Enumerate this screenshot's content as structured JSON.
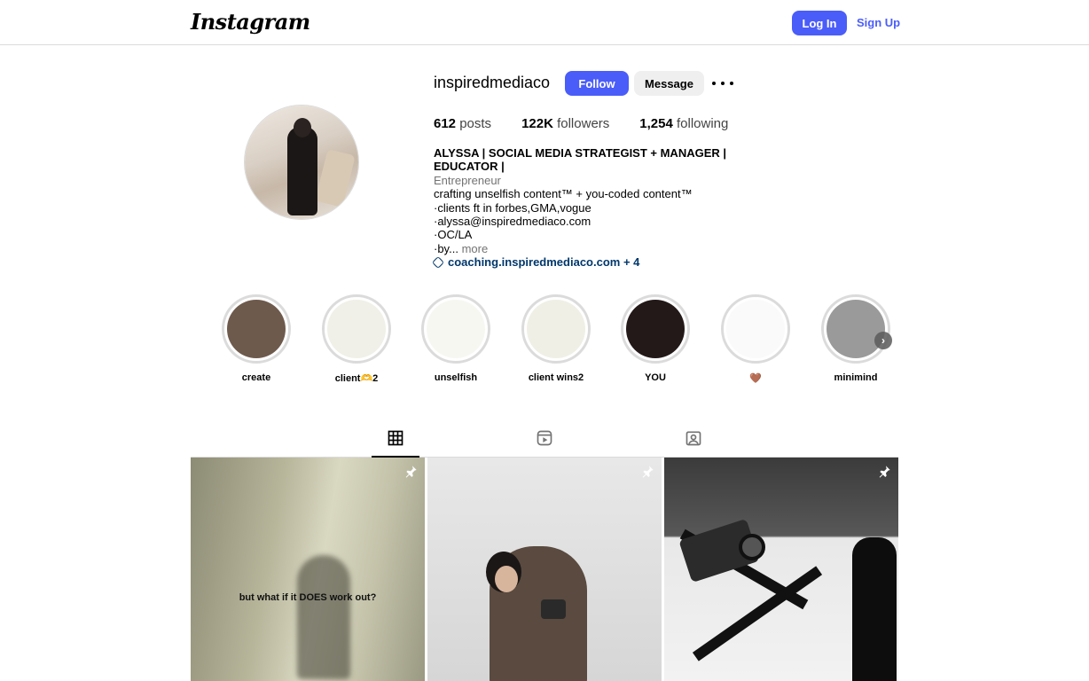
{
  "nav": {
    "logo": "Instagram",
    "login_label": "Log In",
    "signup_label": "Sign Up"
  },
  "profile": {
    "username": "inspiredmediaco",
    "follow_label": "Follow",
    "message_label": "Message",
    "stats": {
      "posts_count": "612",
      "posts_label": "posts",
      "followers_count": "122K",
      "followers_label": "followers",
      "following_count": "1,254",
      "following_label": "following"
    },
    "bio": {
      "name": "ALYSSA | SOCIAL MEDIA STRATEGIST + MANAGER | EDUCATOR |",
      "category": "Entrepreneur",
      "lines": [
        "crafting unselfish content™ + you-coded content™",
        "·clients ft in forbes,GMA,vogue",
        "·alyssa@inspiredmediaco.com",
        "·OC/LA"
      ],
      "truncated_line": "·by...",
      "more_label": "more",
      "link": "coaching.inspiredmediaco.com + 4"
    }
  },
  "highlights": [
    {
      "label": "create",
      "color": "#6e5a4c"
    },
    {
      "label": "client🫶2",
      "color": "#f0f0e8"
    },
    {
      "label": "unselfish",
      "color": "#f7f7f2"
    },
    {
      "label": "client wins2",
      "color": "#efefe6"
    },
    {
      "label": "YOU",
      "color": "#231918"
    },
    {
      "label": "🤎",
      "color": "#fafafa"
    },
    {
      "label": "minimind",
      "color": "#9a9a9a"
    }
  ],
  "posts": [
    {
      "caption": "but what if it DOES work out?"
    },
    {
      "caption": ""
    },
    {
      "caption": ""
    }
  ]
}
